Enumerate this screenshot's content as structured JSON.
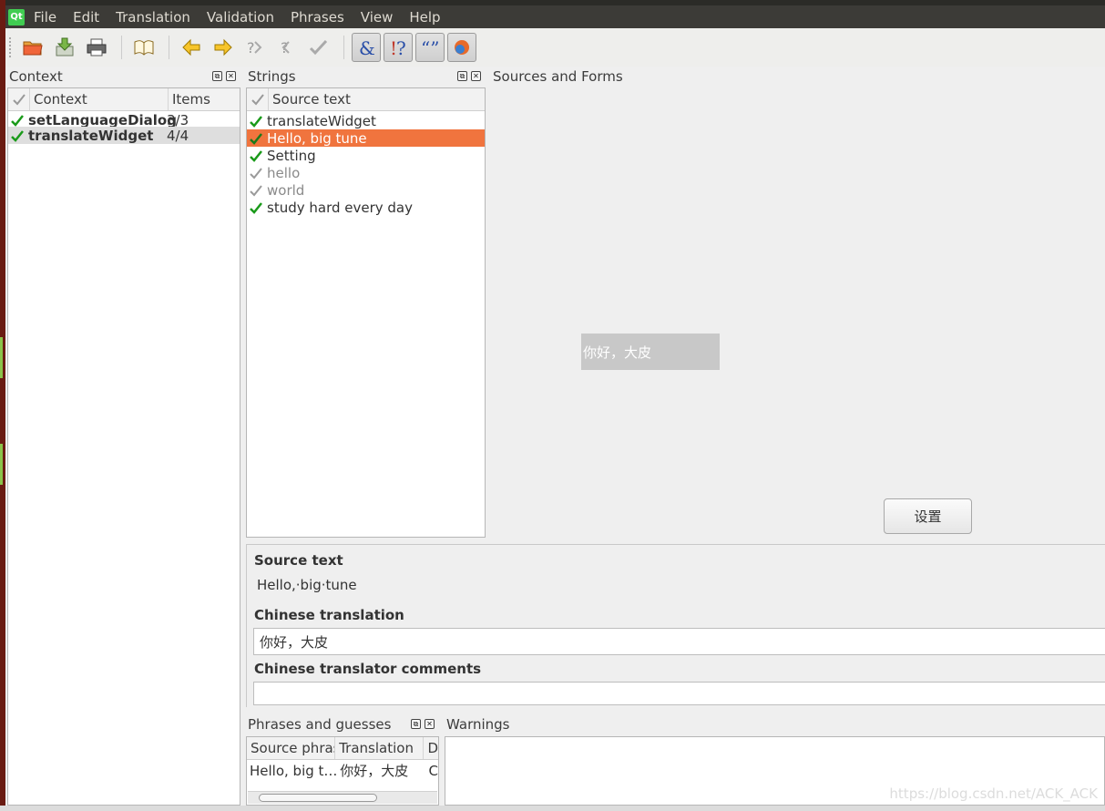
{
  "menu": [
    "File",
    "Edit",
    "Translation",
    "Validation",
    "Phrases",
    "View",
    "Help"
  ],
  "logo": "Qt",
  "toolbar_icons": [
    "open-icon",
    "save-icon",
    "print-icon",
    "phrasebook-icon",
    "prev-icon",
    "next-icon",
    "prev-unfinished-icon",
    "next-unfinished-icon",
    "done-next-icon",
    "accelerator-check-icon",
    "punctuation-check-icon",
    "phrase-match-icon",
    "placeholder-check-icon"
  ],
  "context_panel": {
    "title": "Context",
    "headers": [
      "Context",
      "Items"
    ],
    "rows": [
      {
        "name": "setLanguageDialog",
        "items": "3/3"
      },
      {
        "name": "translateWidget",
        "items": "4/4"
      }
    ]
  },
  "strings_panel": {
    "title": "Strings",
    "header": "Source text",
    "rows": [
      {
        "text": "translateWidget",
        "state": "done"
      },
      {
        "text": "Hello, big tune",
        "state": "done"
      },
      {
        "text": "Setting",
        "state": "done"
      },
      {
        "text": "hello",
        "state": "obsolete"
      },
      {
        "text": "world",
        "state": "obsolete"
      },
      {
        "text": "study hard every day",
        "state": "done"
      }
    ]
  },
  "sources_panel": {
    "title": "Sources and Forms",
    "preview_text": "你好，大皮",
    "button_label": "设置"
  },
  "editor": {
    "source_label": "Source text",
    "source_value": "Hello,·big·tune",
    "translation_label": "Chinese translation",
    "translation_value": "你好，大皮",
    "comments_label": "Chinese translator comments",
    "comments_value": ""
  },
  "phrases_panel": {
    "title": "Phrases and guesses",
    "headers": [
      "Source phrase",
      "Translation",
      "D"
    ],
    "rows": [
      {
        "source": "Hello, big t…",
        "translation": "你好，大皮",
        "d": "C"
      }
    ]
  },
  "warnings_panel": {
    "title": "Warnings"
  },
  "watermark": "https://blog.csdn.net/ACK_ACK",
  "colors": {
    "selection": "#f0743e",
    "check_green": "#1a9a1a",
    "menubar": "#3c3b37"
  }
}
